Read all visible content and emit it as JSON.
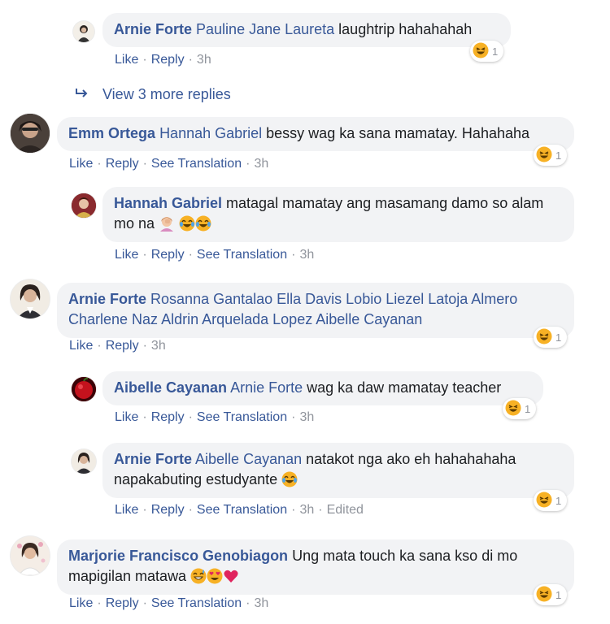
{
  "comments": [
    {
      "author": "Arnie Forte",
      "mentions": "Pauline Jane Laureta",
      "text": " laughtrip hahahahah",
      "actions": [
        "Like",
        "Reply"
      ],
      "time": "3h",
      "reaction_count": "1"
    },
    {
      "author": "Emm Ortega",
      "mentions": "Hannah Gabriel",
      "text": " bessy wag ka sana mamatay. Hahahaha",
      "actions": [
        "Like",
        "Reply",
        "See Translation"
      ],
      "time": "3h",
      "reaction_count": "1"
    },
    {
      "author": "Hannah Gabriel",
      "mentions": "",
      "text": " matagal mamatay ang masamang damo so alam mo na ",
      "actions": [
        "Like",
        "Reply",
        "See Translation"
      ],
      "time": "3h",
      "reaction_count": ""
    },
    {
      "author": "Arnie Forte",
      "mentions": "Rosanna Gantalao Ella Davis Lobio Liezel Latoja Almero Charlene Naz Aldrin Arquelada Lopez Aibelle Cayanan",
      "text": "",
      "actions": [
        "Like",
        "Reply"
      ],
      "time": "3h",
      "reaction_count": "1"
    },
    {
      "author": "Aibelle Cayanan",
      "mentions": "Arnie Forte",
      "text": " wag ka daw mamatay teacher",
      "actions": [
        "Like",
        "Reply",
        "See Translation"
      ],
      "time": "3h",
      "reaction_count": "1"
    },
    {
      "author": "Arnie Forte",
      "mentions": "Aibelle Cayanan",
      "text": " natakot nga ako eh hahahahaha napakabuting estudyante ",
      "actions": [
        "Like",
        "Reply",
        "See Translation"
      ],
      "time": "3h",
      "edited": "Edited",
      "reaction_count": "1"
    },
    {
      "author": "Marjorie Francisco Genobiagon",
      "mentions": "",
      "text": " Ung mata touch ka sana kso di mo mapigilan matawa ",
      "actions": [
        "Like",
        "Reply",
        "See Translation"
      ],
      "time": "3h",
      "reaction_count": "1"
    }
  ],
  "view_more": "View 3 more replies",
  "colors": {
    "link": "#385898",
    "bubble": "#f2f3f5",
    "meta": "#90949c",
    "emoji": "#f7b125"
  },
  "icons": {
    "reaction": "haha-emoji-icon",
    "view_more": "reply-arrow-icon"
  }
}
